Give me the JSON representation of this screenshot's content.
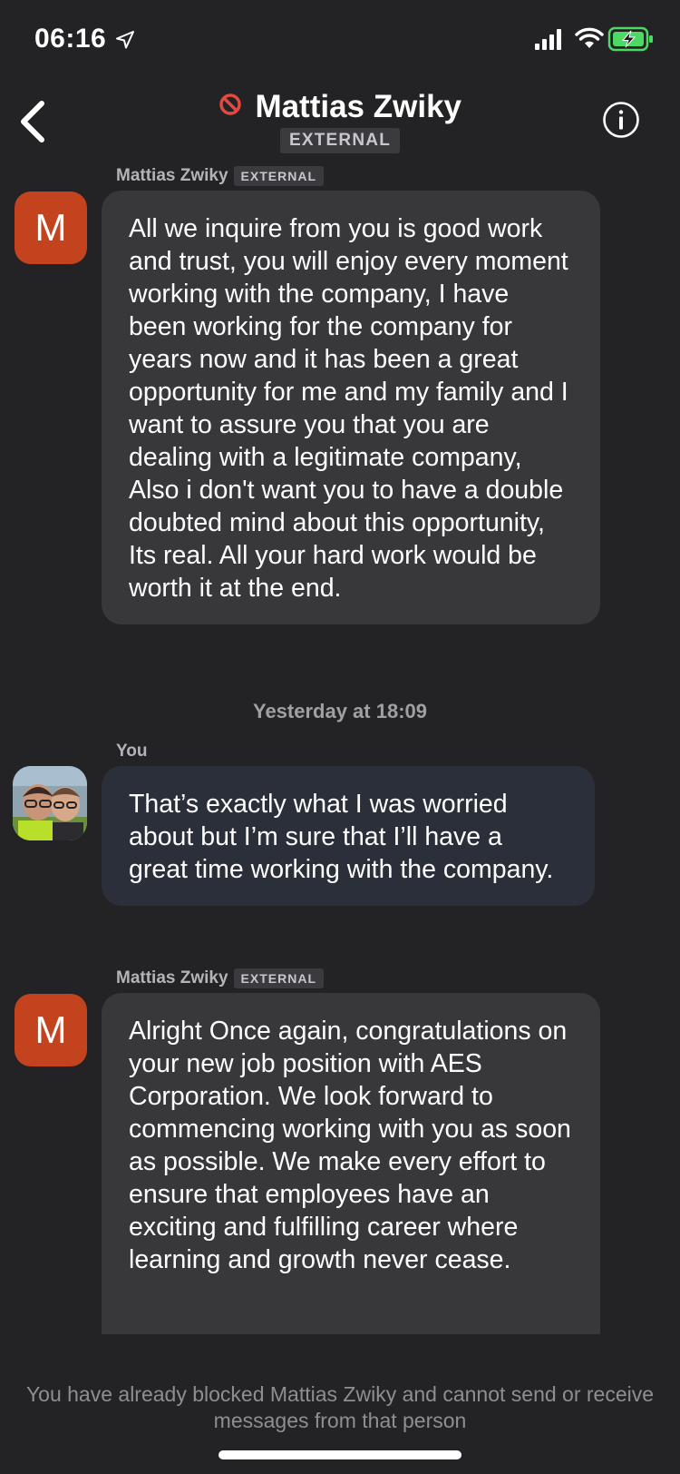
{
  "status_bar": {
    "time": "06:16"
  },
  "header": {
    "title": "Mattias Zwiky",
    "badge": "EXTERNAL"
  },
  "messages": [
    {
      "sender": "Mattias Zwiky",
      "badge": "EXTERNAL",
      "avatar_letter": "M",
      "text": "All we inquire from you is good work and trust, you will enjoy every moment working with the company, I  have been working for the company for years now  and it has been a great opportunity for me and my family and I want to assure you that you are dealing with a legitimate company, Also i don't want you to have a double doubted mind about this opportunity, Its real. All your hard work would be worth it at the end."
    },
    {
      "sender": "You",
      "text": "That’s exactly what I was worried about but I’m sure that I’ll have a great time working with the company."
    },
    {
      "sender": "Mattias Zwiky",
      "badge": "EXTERNAL",
      "avatar_letter": "M",
      "text": "Alright Once again, congratulations on your new job position with AES Corporation. We look forward to commencing working with you as soon as possible. We make every effort to ensure that employees have an exciting and fulfilling career where learning and growth never cease."
    }
  ],
  "timestamp": "Yesterday at 18:09",
  "footer": {
    "blocked_notice": "You have already blocked Mattias Zwiky and cannot send or receive messages from that person"
  },
  "colors": {
    "background": "#232325",
    "incoming_bubble": "#38383b",
    "outgoing_bubble": "#2a2f3a",
    "avatar": "#c4431f",
    "blocked_red": "#e5483e",
    "battery_green": "#4cd964"
  }
}
